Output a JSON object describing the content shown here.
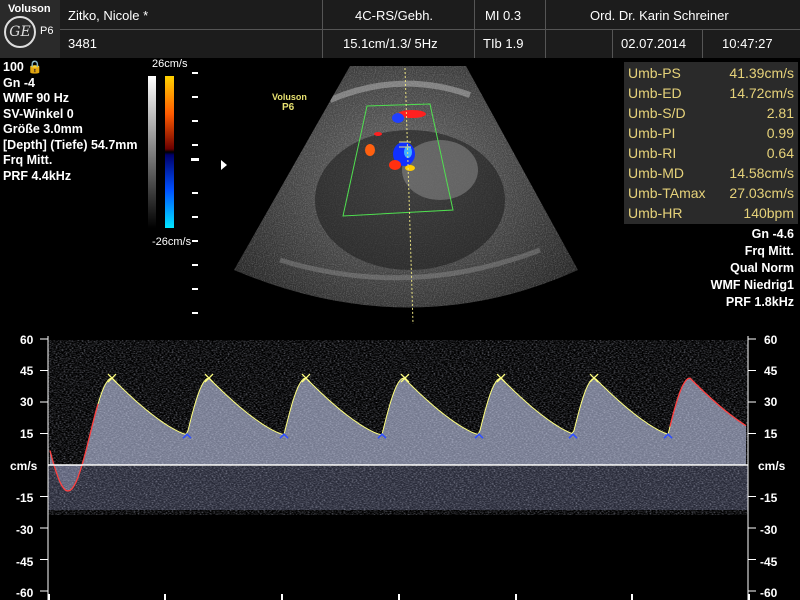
{
  "header": {
    "brand": "Voluson",
    "model": "P6",
    "patient_name": "Zitko, Nicole  *",
    "patient_id": "3481",
    "probe_mode": "4C-RS/Gebh.",
    "depth_freq": "15.1cm/1.3/ 5Hz",
    "mi": "MI  0.3",
    "tib": "TIb  1.9",
    "doctor": "Ord. Dr. Karin Schreiner",
    "date": "02.07.2014",
    "time": "10:47:27"
  },
  "left_params": [
    "100",
    "Gn  -4",
    "WMF 90 Hz",
    "SV-Winkel  0",
    "Größe  3.0mm",
    "[Depth] (Tiefe) 54.7mm",
    "Frq Mitt.",
    "PRF  4.4kHz"
  ],
  "color_scale": {
    "top": "26cm/s",
    "bottom": "-26cm/s"
  },
  "image_label": {
    "brand": "Voluson",
    "model": "P6"
  },
  "measurements": [
    {
      "label": "Umb-PS",
      "value": "41.39cm/s"
    },
    {
      "label": "Umb-ED",
      "value": "14.72cm/s"
    },
    {
      "label": "Umb-S/D",
      "value": "2.81"
    },
    {
      "label": "Umb-PI",
      "value": "0.99"
    },
    {
      "label": "Umb-RI",
      "value": "0.64"
    },
    {
      "label": "Umb-MD",
      "value": "14.58cm/s"
    },
    {
      "label": "Umb-TAmax",
      "value": "27.03cm/s"
    },
    {
      "label": "Umb-HR",
      "value": "140bpm"
    }
  ],
  "right_params": [
    "Gn -4.6",
    "Frq Mitt.",
    "Qual Norm",
    "WMF Niedrig1",
    "PRF  1.8kHz"
  ],
  "doppler_axis": {
    "unit": "cm/s",
    "ticks": [
      "60",
      "45",
      "30",
      "15",
      "-15",
      "-30",
      "-45",
      "-60"
    ]
  },
  "colors": {
    "measure_text": "#e6d27a",
    "envelope": "#ffff80",
    "peak_marker": "#ffff80",
    "edv_marker": "#3050ff",
    "trace": "#ff4040"
  }
}
